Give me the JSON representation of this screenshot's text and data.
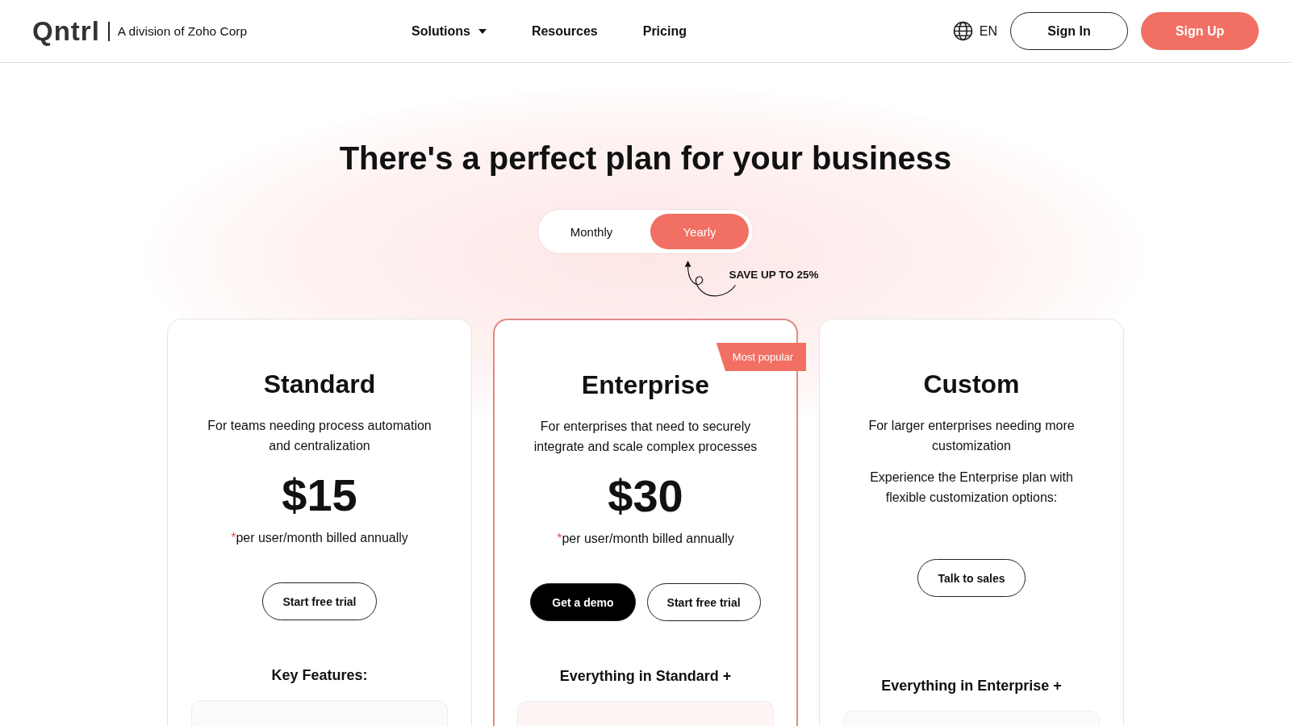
{
  "header": {
    "logo": "Qntrl",
    "tagline": "A division of Zoho Corp",
    "nav": [
      {
        "label": "Solutions",
        "dropdown": true
      },
      {
        "label": "Resources",
        "dropdown": false
      },
      {
        "label": "Pricing",
        "dropdown": false
      }
    ],
    "language": "EN",
    "sign_in": "Sign In",
    "sign_up": "Sign Up"
  },
  "title": "There's a perfect plan for your business",
  "billing": [
    {
      "label": "Monthly",
      "selected": false
    },
    {
      "label": "Yearly",
      "selected": true
    }
  ],
  "savings": "SAVE UP TO 25%",
  "plans": [
    {
      "name": "Standard",
      "highlighted": false,
      "descriptions": [
        "For teams needing process automation and centralization"
      ],
      "price": "$15",
      "note_mark": "*",
      "note": "per user/month billed annually",
      "buttons": [
        {
          "label": "Start free trial",
          "kind": "outline"
        }
      ],
      "features_heading": "Key Features:"
    },
    {
      "name": "Enterprise",
      "highlighted": true,
      "badge": "Most popular",
      "descriptions": [
        "For enterprises that need to securely integrate and scale complex processes"
      ],
      "price": "$30",
      "note_mark": "*",
      "note": "per user/month billed annually",
      "buttons": [
        {
          "label": "Get a demo",
          "kind": "primary"
        },
        {
          "label": "Start free trial",
          "kind": "outline"
        }
      ],
      "features_heading": "Everything in Standard +"
    },
    {
      "name": "Custom",
      "highlighted": false,
      "descriptions": [
        "For larger enterprises needing more customization",
        "Experience the Enterprise plan with flexible customization options:"
      ],
      "buttons": [
        {
          "label": "Talk to sales",
          "kind": "outline"
        }
      ],
      "features_heading": "Everything in Enterprise +"
    }
  ]
}
